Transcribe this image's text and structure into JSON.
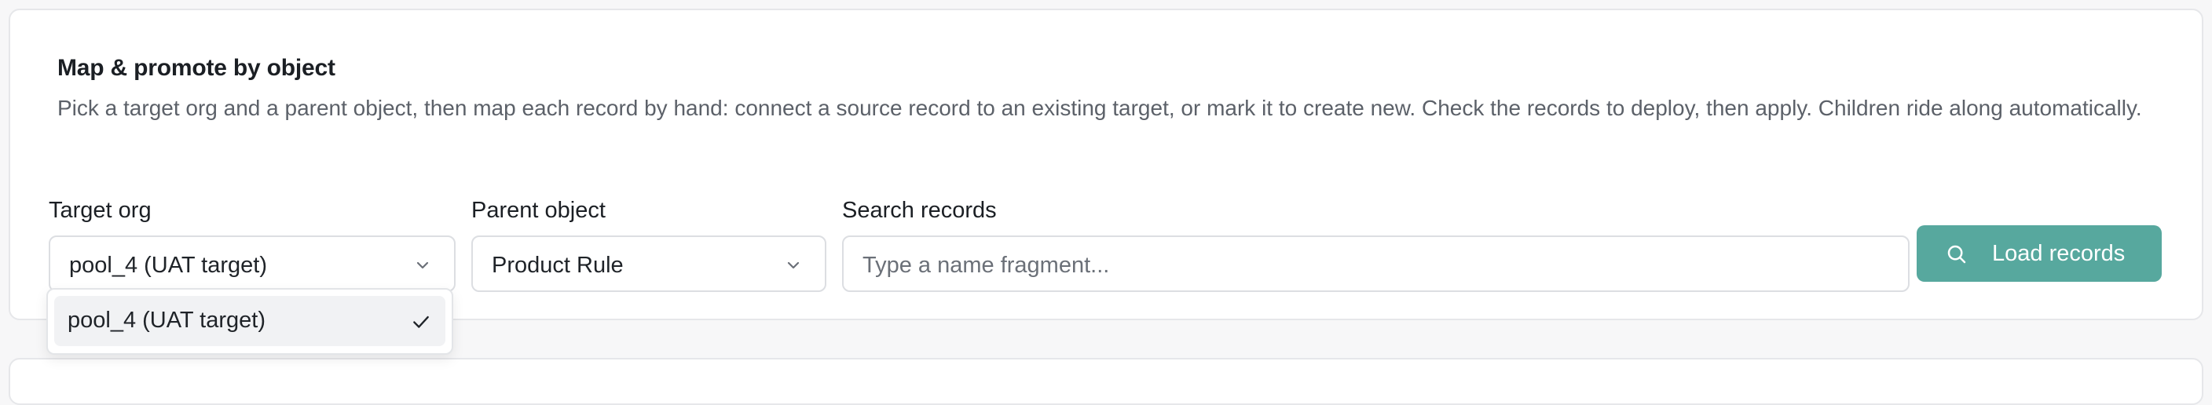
{
  "section": {
    "title": "Map & promote by object",
    "description": "Pick a target org and a parent object, then map each record by hand: connect a source record to an existing target, or mark it to create new. Check the records to deploy, then apply. Children ride along automatically."
  },
  "filters": {
    "target_org": {
      "label": "Target org",
      "value": "pool_4 (UAT target)",
      "options": [
        "pool_4 (UAT target)"
      ]
    },
    "parent_object": {
      "label": "Parent object",
      "value": "Product Rule"
    },
    "search": {
      "label": "Search records",
      "placeholder": "Type a name fragment..."
    },
    "load_button": {
      "label": "Load records",
      "icon": "search-icon"
    }
  },
  "colors": {
    "accent": "#57a89e",
    "border": "#dcdee2",
    "text_muted": "#5c6169"
  }
}
